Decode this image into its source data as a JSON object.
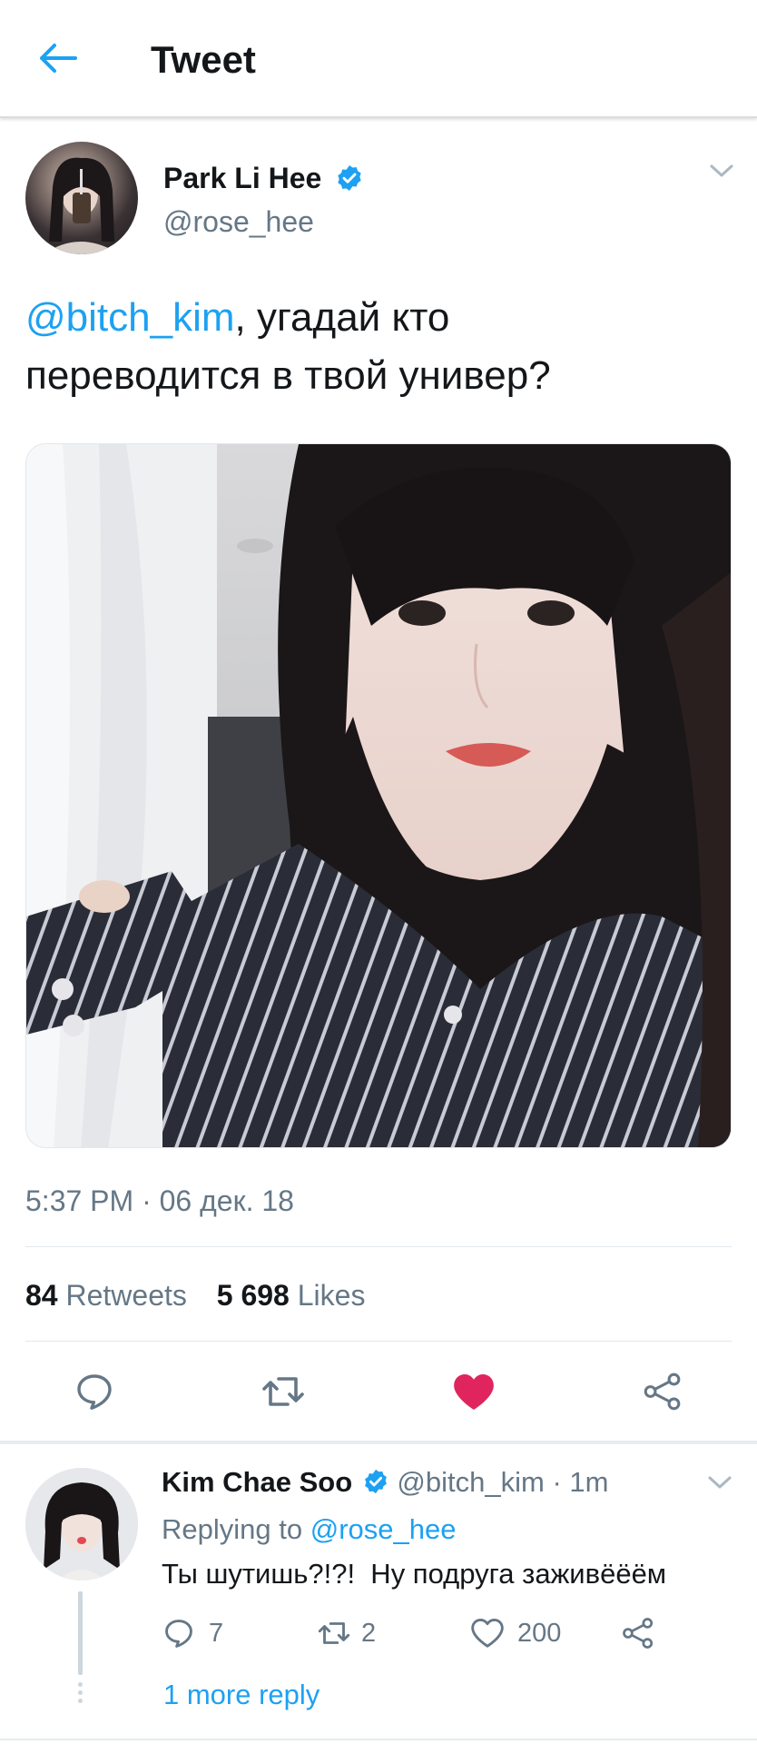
{
  "header": {
    "title": "Tweet"
  },
  "tweet": {
    "author_name": "Park Li Hee",
    "author_handle": "@rose_hee",
    "mention": "@bitch_kim",
    "text_line1_rest": ", угадай кто",
    "text_line2": "переводится в твой универ?",
    "timestamp": "5:37 PM · 06 дек. 18",
    "retweet_count": "84",
    "retweet_label": "Retweets",
    "like_count": "5 698",
    "like_label": "Likes",
    "liked": true
  },
  "reply": {
    "author_name": "Kim Chae Soo",
    "author_handle": "@bitch_kim",
    "time": "· 1m",
    "replying_prefix": "Replying to",
    "replying_to": "@rose_hee",
    "text": "Ты шутишь?!?!  Ну подруга заживёёём",
    "reply_count": "7",
    "retweet_count": "2",
    "like_count": "200",
    "more_replies": "1 more reply"
  },
  "colors": {
    "accent": "#1da1f2",
    "like_red": "#e0245e",
    "muted": "#657786",
    "text": "#14171a"
  },
  "icons": {
    "back": "arrow-left-icon",
    "verified": "verified-badge-icon",
    "caret": "chevron-down-icon",
    "reply": "reply-icon",
    "retweet": "retweet-icon",
    "like": "heart-icon",
    "share": "share-icon"
  }
}
